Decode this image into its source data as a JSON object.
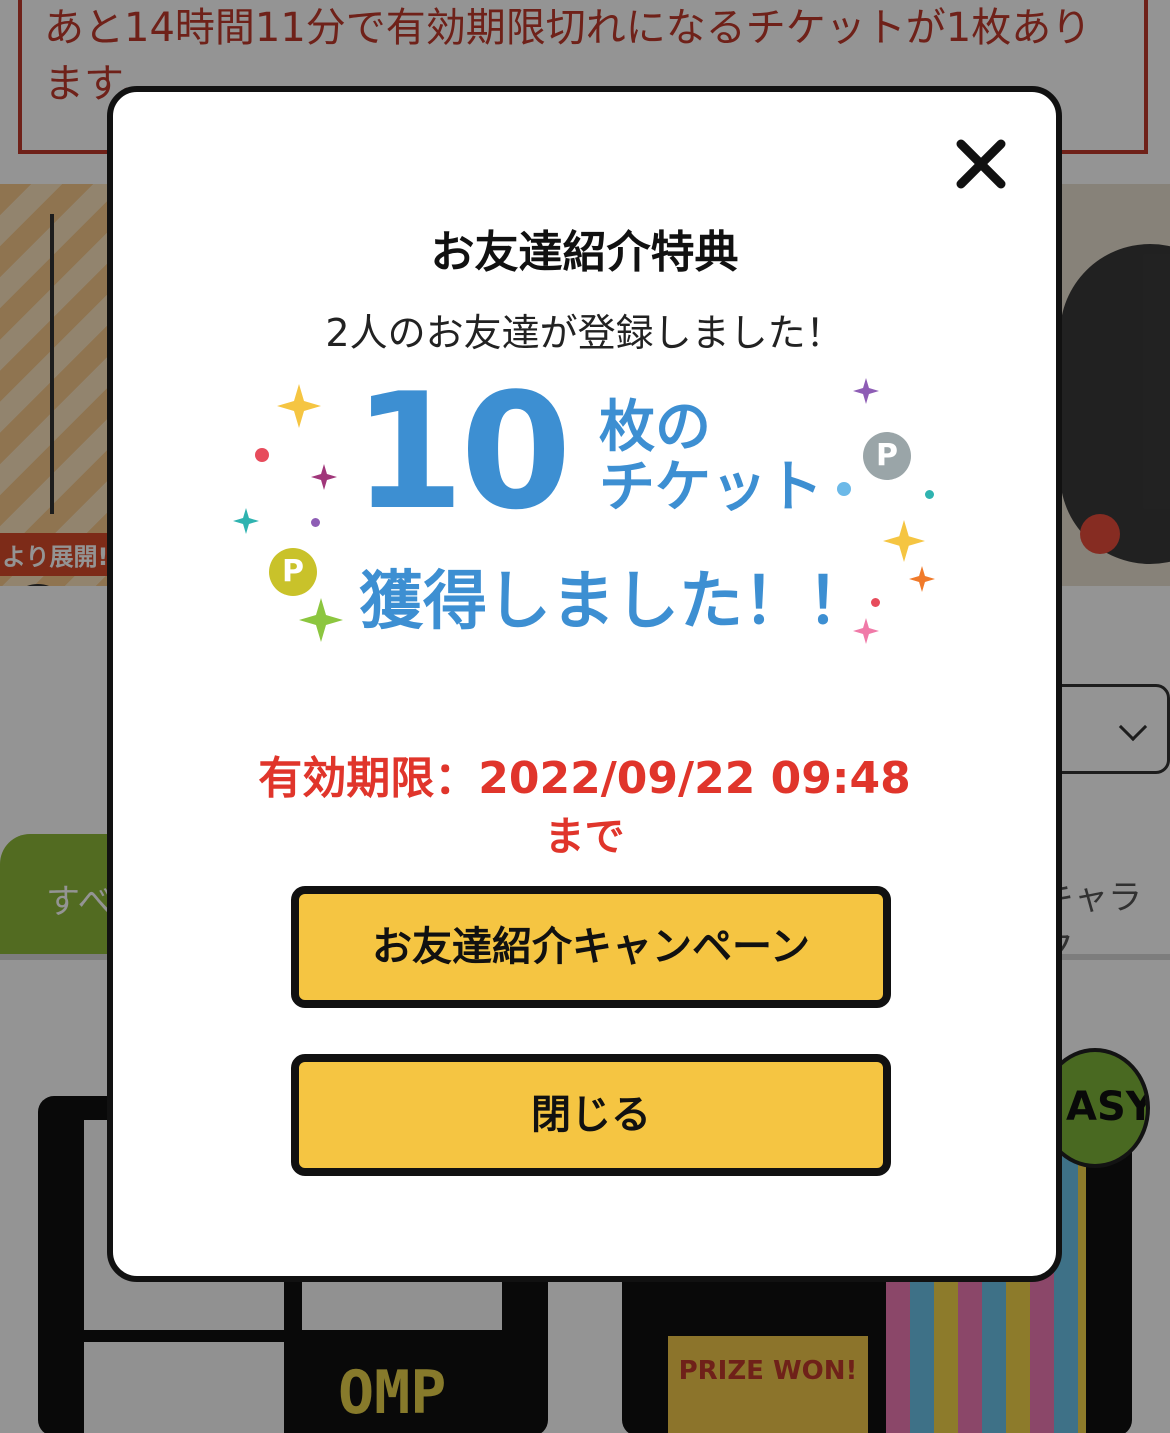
{
  "notice": {
    "text": "あと14時間11分で有効期限切れになるチケットが1枚あります。"
  },
  "background": {
    "banner_left_tag": "より展開!",
    "tab_all_label": "すべ",
    "tab_character_label": "キャラク",
    "card_left_text": "OMP",
    "card_right_text": "PRIZE WON!",
    "easy_badge": "ASY"
  },
  "modal": {
    "title": "お友達紹介特典",
    "subtitle": "2人のお友達が登録しました！",
    "ticket_count": "10",
    "ticket_unit_line1": "枚の",
    "ticket_unit_line2": "チケット",
    "acquired_text": "獲得しました！！",
    "p_coin_label": "P",
    "expiry_label": "有効期限：2022/09/22 09:48",
    "expiry_suffix": "まで",
    "campaign_button": "お友達紹介キャンペーン",
    "close_button": "閉じる"
  },
  "colors": {
    "accent_blue": "#3d8fd2",
    "button_yellow": "#f5c542",
    "expiry_red": "#e0352b",
    "notice_red": "#c0392b"
  }
}
